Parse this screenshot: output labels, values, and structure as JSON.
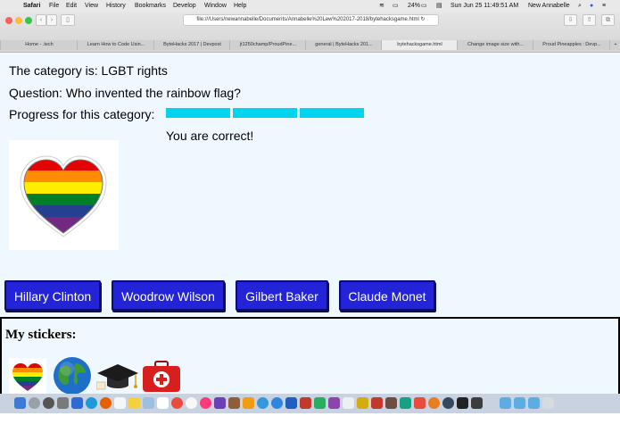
{
  "menubar": {
    "app": "Safari",
    "items": [
      "File",
      "Edit",
      "View",
      "History",
      "Bookmarks",
      "Develop",
      "Window",
      "Help"
    ],
    "battery": "24%",
    "datetime": "Sun Jun 25  11:49:51 AM",
    "user": "New Annabelle"
  },
  "browser": {
    "url": "file:///Users/newannabelle/Documents/Annabelle%20Lew%202017-2018/bytehacksgame.html",
    "tabs": [
      "Home - .tech",
      "Learn How to Code Usin...",
      "ByteHacks 2017 | Devpost",
      "jt1250champ/ProudPine...",
      "general | ByteHacks 201...",
      "bytehacksgame.html",
      "Change image size with...",
      "Proud Pineapples : Devp..."
    ],
    "active_tab": 5
  },
  "game": {
    "category_line": "The category is: LGBT rights",
    "question_line": "Question: Who invented the rainbow flag?",
    "progress_label": "Progress for this category:",
    "progress_filled": 3,
    "feedback": "You are correct!",
    "answers": [
      "Hillary Clinton",
      "Woodrow Wilson",
      "Gilbert Baker",
      "Claude Monet"
    ],
    "colors": {
      "progress": "#00d4ee",
      "button": "#2323d8",
      "page_bg": "#f0f8ff"
    }
  },
  "stickers": {
    "title": "My stickers:",
    "items": [
      "rainbow-heart-icon",
      "globe-icon",
      "graduation-cap-icon",
      "first-aid-kit-icon"
    ]
  }
}
